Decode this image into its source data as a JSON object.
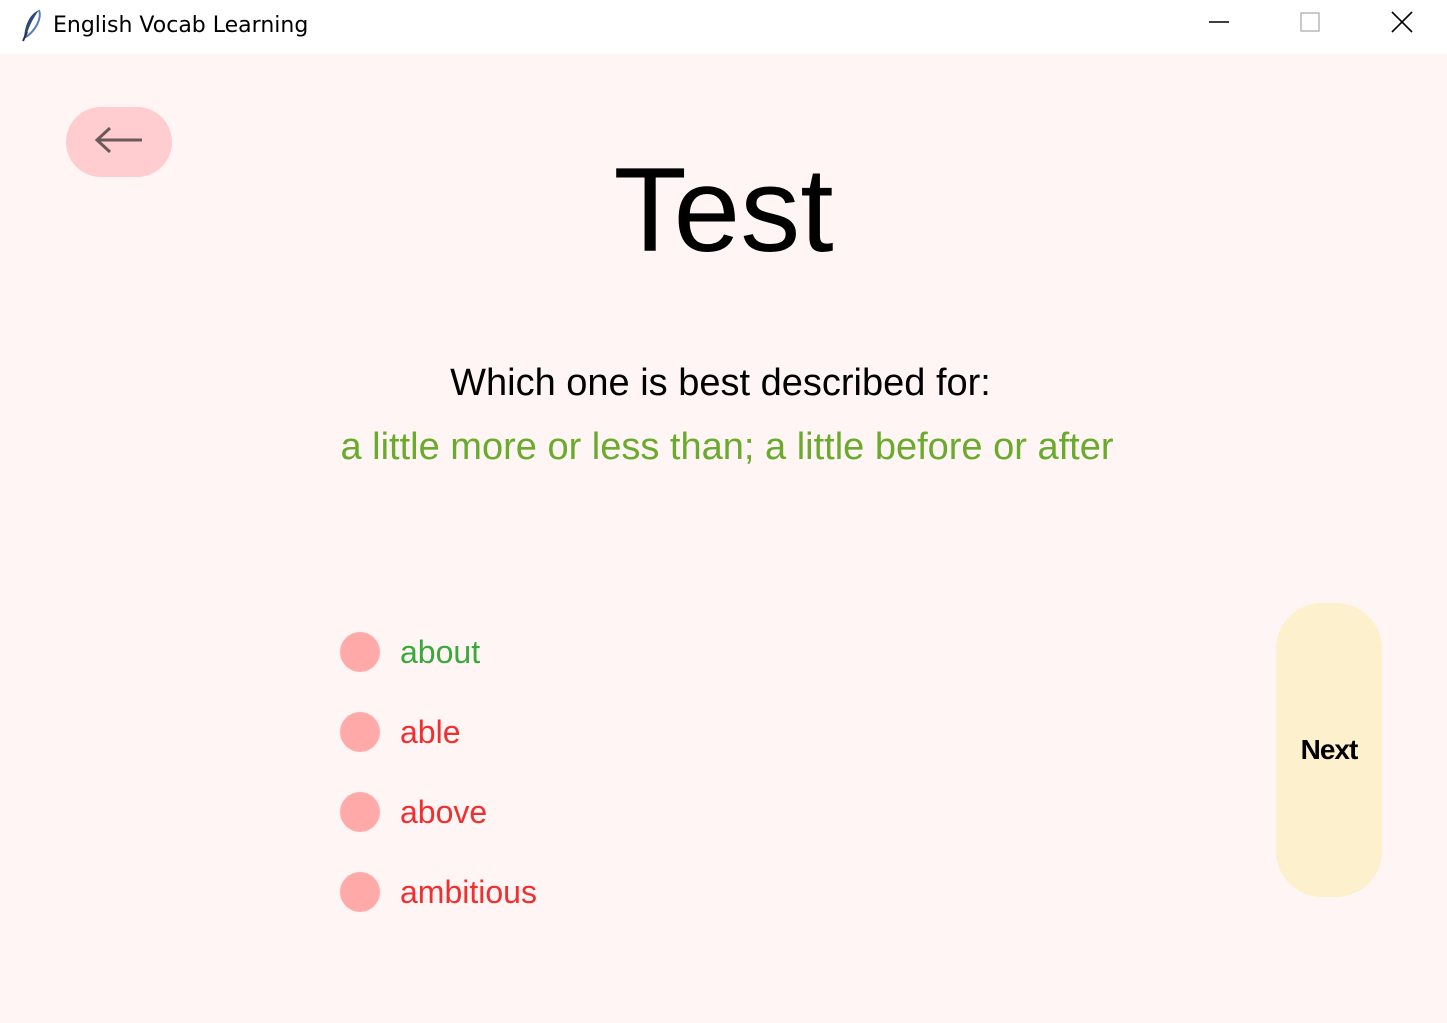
{
  "window": {
    "title": "English Vocab Learning",
    "app_icon": "feather-icon",
    "controls": [
      "minimize-icon",
      "maximize-icon",
      "close-icon"
    ]
  },
  "header": {
    "back_icon": "arrow-left-icon",
    "title": "Test"
  },
  "quiz": {
    "question": "Which one is best described for:",
    "definition": "a little more or less than; a little before or after",
    "options": [
      {
        "label": "about",
        "color": "#3aa83a",
        "status": "correct"
      },
      {
        "label": "able",
        "color": "#f03030",
        "status": "incorrect"
      },
      {
        "label": "above",
        "color": "#f03030",
        "status": "incorrect"
      },
      {
        "label": "ambitious",
        "color": "#f03030",
        "status": "incorrect"
      }
    ],
    "next_label": "Next"
  },
  "colors": {
    "background": "#fff5f4",
    "back_button": "#ffccd0",
    "radio": "#ffa9a9",
    "definition_text": "#6aaa2c",
    "next_button": "#fdf0cc",
    "correct": "#3aa83a",
    "incorrect": "#f03030"
  }
}
